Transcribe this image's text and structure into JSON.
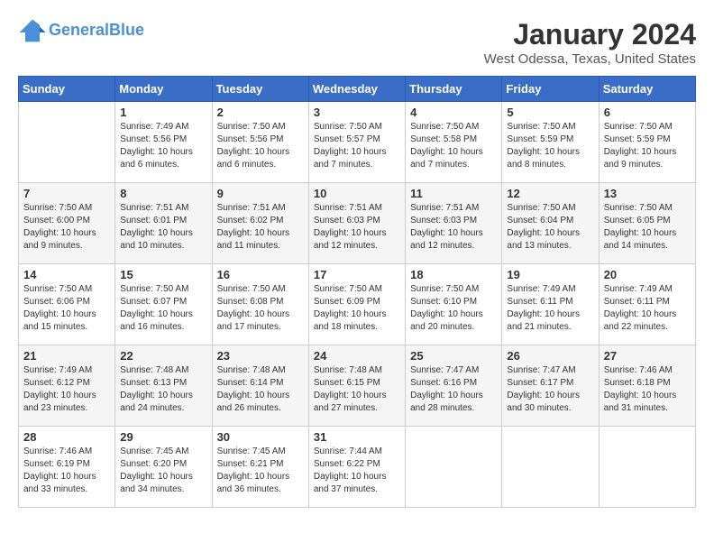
{
  "header": {
    "logo_line1": "General",
    "logo_line2": "Blue",
    "title": "January 2024",
    "subtitle": "West Odessa, Texas, United States"
  },
  "calendar": {
    "days_of_week": [
      "Sunday",
      "Monday",
      "Tuesday",
      "Wednesday",
      "Thursday",
      "Friday",
      "Saturday"
    ],
    "weeks": [
      [
        {
          "day": "",
          "info": ""
        },
        {
          "day": "1",
          "info": "Sunrise: 7:49 AM\nSunset: 5:56 PM\nDaylight: 10 hours and 6 minutes."
        },
        {
          "day": "2",
          "info": "Sunrise: 7:50 AM\nSunset: 5:56 PM\nDaylight: 10 hours and 6 minutes."
        },
        {
          "day": "3",
          "info": "Sunrise: 7:50 AM\nSunset: 5:57 PM\nDaylight: 10 hours and 7 minutes."
        },
        {
          "day": "4",
          "info": "Sunrise: 7:50 AM\nSunset: 5:58 PM\nDaylight: 10 hours and 7 minutes."
        },
        {
          "day": "5",
          "info": "Sunrise: 7:50 AM\nSunset: 5:59 PM\nDaylight: 10 hours and 8 minutes."
        },
        {
          "day": "6",
          "info": "Sunrise: 7:50 AM\nSunset: 5:59 PM\nDaylight: 10 hours and 9 minutes."
        }
      ],
      [
        {
          "day": "7",
          "info": "Sunrise: 7:50 AM\nSunset: 6:00 PM\nDaylight: 10 hours and 9 minutes."
        },
        {
          "day": "8",
          "info": "Sunrise: 7:51 AM\nSunset: 6:01 PM\nDaylight: 10 hours and 10 minutes."
        },
        {
          "day": "9",
          "info": "Sunrise: 7:51 AM\nSunset: 6:02 PM\nDaylight: 10 hours and 11 minutes."
        },
        {
          "day": "10",
          "info": "Sunrise: 7:51 AM\nSunset: 6:03 PM\nDaylight: 10 hours and 12 minutes."
        },
        {
          "day": "11",
          "info": "Sunrise: 7:51 AM\nSunset: 6:03 PM\nDaylight: 10 hours and 12 minutes."
        },
        {
          "day": "12",
          "info": "Sunrise: 7:50 AM\nSunset: 6:04 PM\nDaylight: 10 hours and 13 minutes."
        },
        {
          "day": "13",
          "info": "Sunrise: 7:50 AM\nSunset: 6:05 PM\nDaylight: 10 hours and 14 minutes."
        }
      ],
      [
        {
          "day": "14",
          "info": "Sunrise: 7:50 AM\nSunset: 6:06 PM\nDaylight: 10 hours and 15 minutes."
        },
        {
          "day": "15",
          "info": "Sunrise: 7:50 AM\nSunset: 6:07 PM\nDaylight: 10 hours and 16 minutes."
        },
        {
          "day": "16",
          "info": "Sunrise: 7:50 AM\nSunset: 6:08 PM\nDaylight: 10 hours and 17 minutes."
        },
        {
          "day": "17",
          "info": "Sunrise: 7:50 AM\nSunset: 6:09 PM\nDaylight: 10 hours and 18 minutes."
        },
        {
          "day": "18",
          "info": "Sunrise: 7:50 AM\nSunset: 6:10 PM\nDaylight: 10 hours and 20 minutes."
        },
        {
          "day": "19",
          "info": "Sunrise: 7:49 AM\nSunset: 6:11 PM\nDaylight: 10 hours and 21 minutes."
        },
        {
          "day": "20",
          "info": "Sunrise: 7:49 AM\nSunset: 6:11 PM\nDaylight: 10 hours and 22 minutes."
        }
      ],
      [
        {
          "day": "21",
          "info": "Sunrise: 7:49 AM\nSunset: 6:12 PM\nDaylight: 10 hours and 23 minutes."
        },
        {
          "day": "22",
          "info": "Sunrise: 7:48 AM\nSunset: 6:13 PM\nDaylight: 10 hours and 24 minutes."
        },
        {
          "day": "23",
          "info": "Sunrise: 7:48 AM\nSunset: 6:14 PM\nDaylight: 10 hours and 26 minutes."
        },
        {
          "day": "24",
          "info": "Sunrise: 7:48 AM\nSunset: 6:15 PM\nDaylight: 10 hours and 27 minutes."
        },
        {
          "day": "25",
          "info": "Sunrise: 7:47 AM\nSunset: 6:16 PM\nDaylight: 10 hours and 28 minutes."
        },
        {
          "day": "26",
          "info": "Sunrise: 7:47 AM\nSunset: 6:17 PM\nDaylight: 10 hours and 30 minutes."
        },
        {
          "day": "27",
          "info": "Sunrise: 7:46 AM\nSunset: 6:18 PM\nDaylight: 10 hours and 31 minutes."
        }
      ],
      [
        {
          "day": "28",
          "info": "Sunrise: 7:46 AM\nSunset: 6:19 PM\nDaylight: 10 hours and 33 minutes."
        },
        {
          "day": "29",
          "info": "Sunrise: 7:45 AM\nSunset: 6:20 PM\nDaylight: 10 hours and 34 minutes."
        },
        {
          "day": "30",
          "info": "Sunrise: 7:45 AM\nSunset: 6:21 PM\nDaylight: 10 hours and 36 minutes."
        },
        {
          "day": "31",
          "info": "Sunrise: 7:44 AM\nSunset: 6:22 PM\nDaylight: 10 hours and 37 minutes."
        },
        {
          "day": "",
          "info": ""
        },
        {
          "day": "",
          "info": ""
        },
        {
          "day": "",
          "info": ""
        }
      ]
    ]
  }
}
